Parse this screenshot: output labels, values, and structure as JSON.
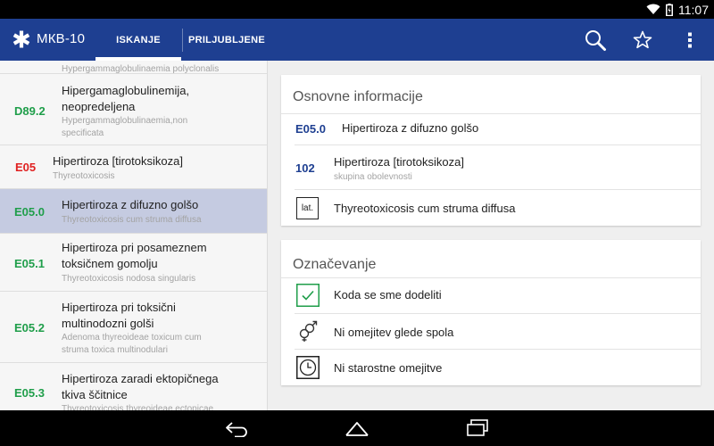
{
  "status_bar": {
    "time": "11:07"
  },
  "app_bar": {
    "title": "МКВ-10",
    "tabs": [
      {
        "label": "ISKANJE",
        "selected": true
      },
      {
        "label": "PRILJUBLJENE",
        "selected": false
      }
    ],
    "actions": [
      "search-icon",
      "star-icon",
      "more-icon"
    ],
    "color": "#1e3f91"
  },
  "list": {
    "partial_top_subtitle": "Hypergammaglobulinaemia polyclonalis",
    "items": [
      {
        "code": "D89.2",
        "code_color": "#1f9e4a",
        "title_lines": [
          "Hipergamaglobulinemija,",
          "neopredeljena"
        ],
        "subtitle_lines": [
          "Hypergammaglobulinaemia,non",
          "specificata"
        ]
      },
      {
        "code": "E05",
        "code_color": "#e02020",
        "title_lines": [
          "Hipertiroza [tirotoksikoza]"
        ],
        "subtitle_lines": [
          "Thyreotoxicosis"
        ]
      },
      {
        "code": "E05.0",
        "code_color": "#1f9e4a",
        "title_lines": [
          "Hipertiroza z difuzno golšo"
        ],
        "subtitle_lines": [
          "Thyreotoxicosis cum struma diffusa"
        ],
        "selected": true
      },
      {
        "code": "E05.1",
        "code_color": "#1f9e4a",
        "title_lines": [
          "Hipertiroza pri posameznem",
          "toksičnem gomolju"
        ],
        "subtitle_lines": [
          "Thyreotoxicosis nodosa singularis"
        ]
      },
      {
        "code": "E05.2",
        "code_color": "#1f9e4a",
        "title_lines": [
          "Hipertiroza pri toksični",
          "multinodozni golši"
        ],
        "subtitle_lines": [
          "Adenoma thyreoideae toxicum cum",
          "struma toxica multinodulari"
        ]
      },
      {
        "code": "E05.3",
        "code_color": "#1f9e4a",
        "title_lines": [
          "Hipertiroza zaradi ektopičnega",
          "tkiva ščitnice"
        ],
        "subtitle_lines": [
          "Thyreotoxicosis thyreoideae ectopicae"
        ]
      }
    ]
  },
  "basic_info": {
    "heading": "Osnovne informacije",
    "code": "E05.0",
    "code_title": "Hipertiroza z difuzno golšo",
    "group_code": "102",
    "group_title": "Hipertiroza [tirotoksikoza]",
    "group_subtitle": "skupina obolevnosti",
    "latin_label": "lat.",
    "latin_text": "Thyreotoxicosis cum struma diffusa"
  },
  "marking": {
    "heading": "Označevanje",
    "items": [
      {
        "icon": "check-icon",
        "text": "Koda se sme dodeliti"
      },
      {
        "icon": "gender-icon",
        "text": "Ni omejitev glede spola"
      },
      {
        "icon": "clock-icon",
        "text": "Ni starostne omejitve"
      }
    ]
  }
}
